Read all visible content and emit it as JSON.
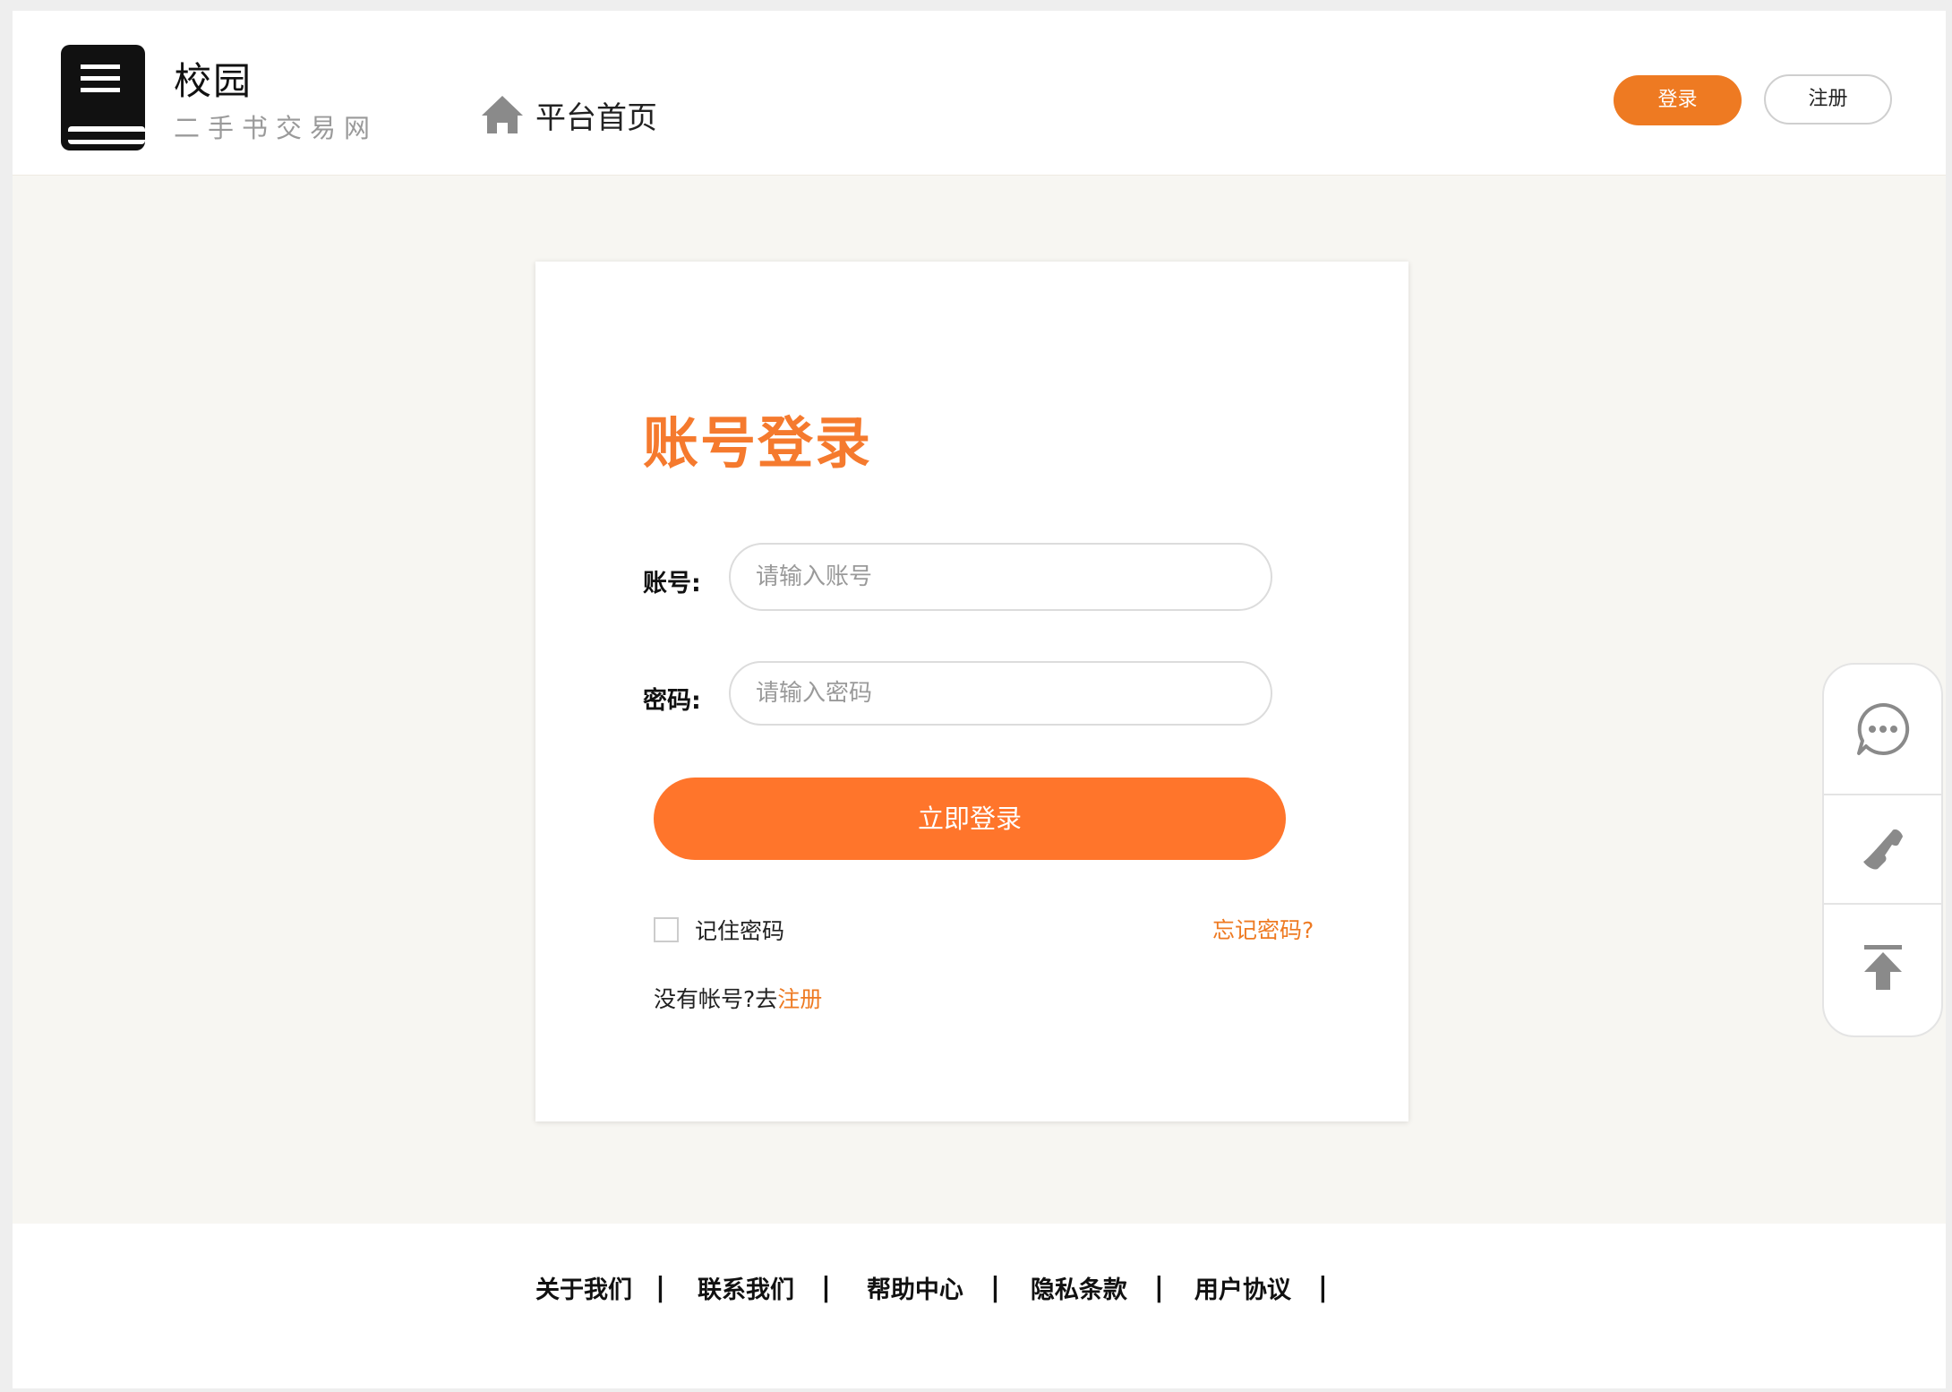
{
  "header": {
    "logo_title": "校园",
    "logo_subtitle": "二手书交易网",
    "nav_home": "平台首页",
    "login_label": "登录",
    "register_label": "注册"
  },
  "login_card": {
    "title": "账号登录",
    "account_label": "账号:",
    "account_placeholder": "请输入账号",
    "account_value": "",
    "password_label": "密码:",
    "password_placeholder": "请输入密码",
    "password_value": "",
    "submit_label": "立即登录",
    "remember_label": "记住密码",
    "remember_checked": false,
    "forgot_label": "忘记密码?",
    "no_account_text": "没有帐号?去",
    "register_link": "注册"
  },
  "side_tools": [
    "chat-icon",
    "phone-icon",
    "back-to-top-icon"
  ],
  "footer": {
    "links": [
      {
        "label": "关于我们",
        "sep": "|"
      },
      {
        "label": "联系我们",
        "sep": "|"
      },
      {
        "label": "帮助中心",
        "sep": "|"
      },
      {
        "label": "隐私条款",
        "sep": "|"
      },
      {
        "label": "用户协议",
        "sep": "|"
      }
    ]
  },
  "colors": {
    "accent": "#ee7a22",
    "submit": "#ff752b",
    "title": "#f57a2e",
    "page_background": "#f7f6f2"
  }
}
